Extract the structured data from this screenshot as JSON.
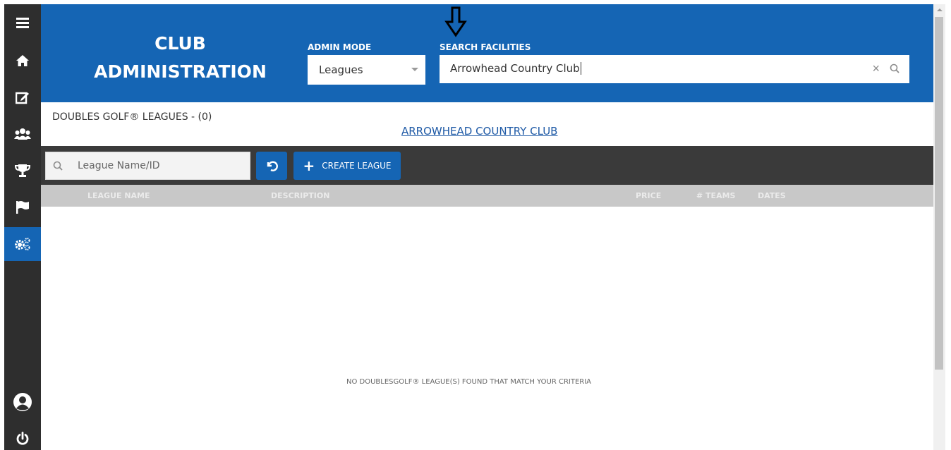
{
  "header": {
    "title_line1": "CLUB",
    "title_line2": "ADMINISTRATION",
    "admin_mode_label": "ADMIN MODE",
    "admin_mode_value": "Leagues",
    "search_label": "SEARCH FACILITIES",
    "search_value": "Arrowhead Country Club"
  },
  "sidebar": {
    "items": [
      {
        "name": "menu-icon"
      },
      {
        "name": "home-icon"
      },
      {
        "name": "edit-icon"
      },
      {
        "name": "users-icon"
      },
      {
        "name": "trophy-icon"
      },
      {
        "name": "flag-icon"
      },
      {
        "name": "gears-icon",
        "active": true
      },
      {
        "name": "profile-icon"
      },
      {
        "name": "power-icon"
      }
    ]
  },
  "content": {
    "leagues_heading": "DOUBLES GOLF® LEAGUES - (0)",
    "facility_link": "ARROWHEAD COUNTRY CLUB",
    "empty_message": "NO DOUBLESGOLF® LEAGUE(S) FOUND THAT MATCH YOUR CRITERIA"
  },
  "toolbar": {
    "search_placeholder": "League Name/ID",
    "create_label": "CREATE LEAGUE"
  },
  "table": {
    "columns": [
      "LEAGUE NAME",
      "DESCRIPTION",
      "PRICE",
      "# TEAMS",
      "DATES"
    ]
  },
  "colors": {
    "brand_blue": "#1565b4",
    "sidebar_dark": "#2e2e2e",
    "toolbar_dark": "#3a3a3a",
    "table_header": "#c8c8c8",
    "link": "#1f5aa6"
  }
}
